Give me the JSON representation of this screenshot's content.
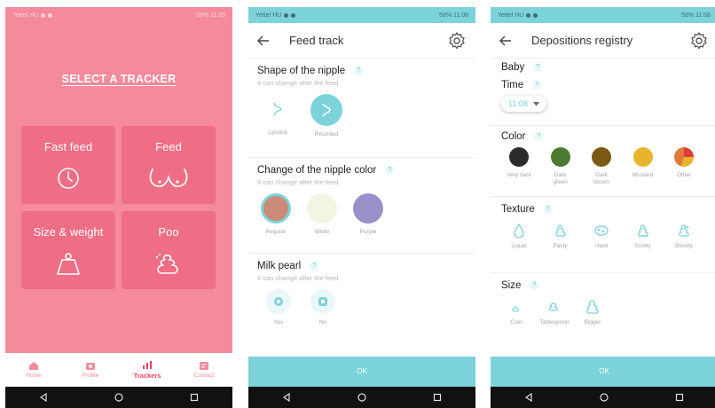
{
  "status": {
    "carrier": "Yettel HU",
    "battery_time": "58% 11:09",
    "battery_time_2": "58% 11:08"
  },
  "trackers": {
    "title": "SELECT A TRACKER",
    "tiles": [
      {
        "label": "Fast feed",
        "icon": "clock-icon"
      },
      {
        "label": "Feed",
        "icon": "breast-icon"
      },
      {
        "label": "Size & weight",
        "icon": "scale-weight-icon"
      },
      {
        "label": "Poo",
        "icon": "poo-icon"
      }
    ],
    "nav": [
      {
        "label": "Home",
        "icon": "home-icon"
      },
      {
        "label": "Profile",
        "icon": "profile-icon"
      },
      {
        "label": "Trackers",
        "icon": "trackers-icon"
      },
      {
        "label": "Contact",
        "icon": "contact-icon"
      }
    ]
  },
  "feed": {
    "title": "Feed track",
    "shape": {
      "title": "Shape of the nipple",
      "sub": "It can change after the feed",
      "options": [
        "Lipstick",
        "Rounded"
      ]
    },
    "color": {
      "title": "Change of the nipple color",
      "sub": "It can change after the feed",
      "options": [
        "Regular",
        "White",
        "Purple"
      ],
      "colors": [
        "#c98a78",
        "#f3f4e3",
        "#9b8fc9"
      ]
    },
    "pearl": {
      "title": "Milk pearl",
      "sub": "It can change after the feed",
      "options": [
        "Yes",
        "No"
      ]
    },
    "ok": "OK"
  },
  "registry": {
    "title": "Depositions registry",
    "baby": "Baby",
    "time_label": "Time",
    "time_value": "11:08",
    "color_label": "Color",
    "colors": [
      {
        "label": "Very dark",
        "hex": "#2a2c2e"
      },
      {
        "label": "Dark green",
        "hex": "#4c7a2e"
      },
      {
        "label": "Dark brown",
        "hex": "#7a5a12"
      },
      {
        "label": "Mustard",
        "hex": "#e7b52c"
      },
      {
        "label": "Other",
        "hex": "#e07a3c"
      }
    ],
    "texture_label": "Texture",
    "textures": [
      "Liquid",
      "Pasty",
      "Hard",
      "Snotty",
      "Bloody"
    ],
    "size_label": "Size",
    "sizes": [
      "Coin",
      "Tablespoon",
      "Bigger"
    ],
    "ok": "OK"
  },
  "accent": "#7dd3da",
  "pink": "#f48a9b"
}
